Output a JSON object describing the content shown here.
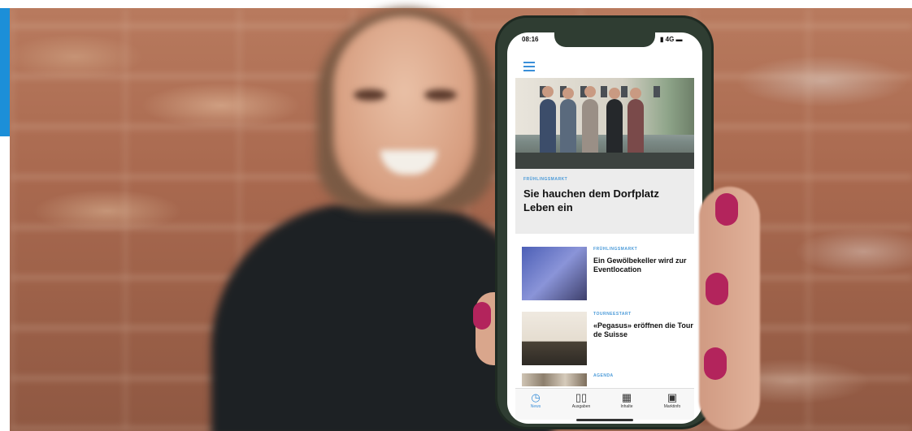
{
  "phone": {
    "status_time": "08:16",
    "status_right": "▮ 4G ▬",
    "hero_article": {
      "kicker": "FRÜHLINGSMARKT",
      "title": "Sie hauchen dem Dorfplatz Leben ein"
    },
    "articles": [
      {
        "kicker": "FRÜHLINGSMARKT",
        "title": "Ein Gewölbekeller wird zur Eventlocation"
      },
      {
        "kicker": "TOURNEESTART",
        "title": "«Pegasus» eröffnen die Tour de Suisse"
      },
      {
        "kicker": "AGENDA",
        "title": ""
      }
    ],
    "tabs": [
      {
        "label": "News",
        "icon": "clock-icon",
        "active": true
      },
      {
        "label": "Ausgaben",
        "icon": "book-icon",
        "active": false
      },
      {
        "label": "Inhalte",
        "icon": "grid-icon",
        "active": false
      },
      {
        "label": "Marktinfo",
        "icon": "marketplace-icon",
        "active": false
      }
    ]
  },
  "colors": {
    "accent_blue": "#1c8fd8",
    "phone_case": "#2f3d32",
    "nail_polish": "#b3245c"
  }
}
